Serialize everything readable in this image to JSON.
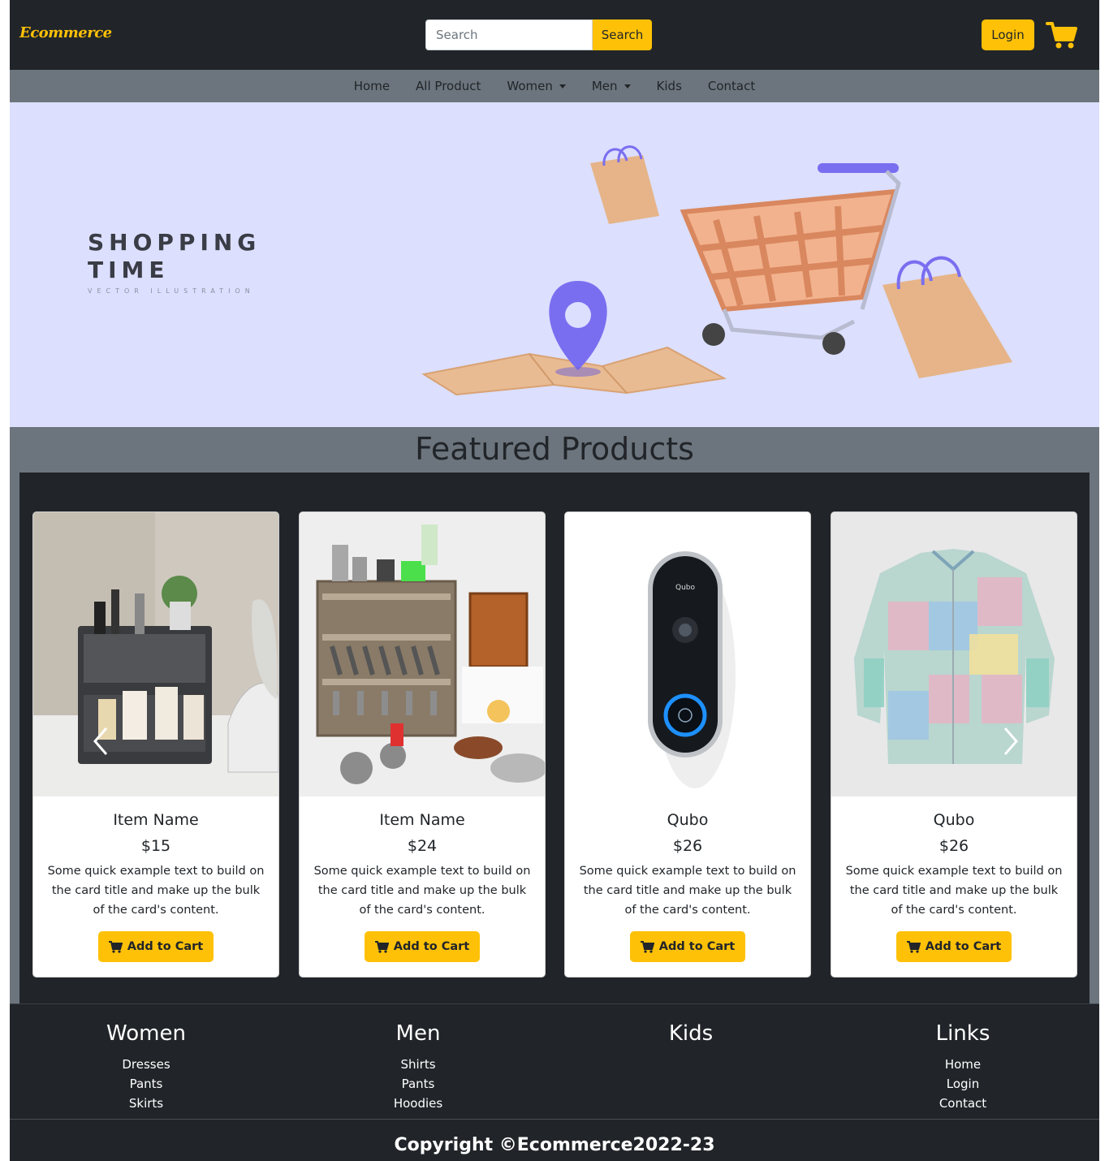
{
  "header": {
    "brand": "Ecommerce",
    "search_placeholder": "Search",
    "search_button": "Search",
    "login_button": "Login",
    "cart_icon": "shopping-cart-icon",
    "accent_color": "#ffc107"
  },
  "nav": {
    "items": [
      {
        "label": "Home",
        "dropdown": false
      },
      {
        "label": "All Product",
        "dropdown": false
      },
      {
        "label": "Women",
        "dropdown": true
      },
      {
        "label": "Men",
        "dropdown": true
      },
      {
        "label": "Kids",
        "dropdown": false
      },
      {
        "label": "Contact",
        "dropdown": false
      }
    ]
  },
  "hero": {
    "title_line1": "SHOPPING",
    "title_line2": "TIME",
    "subtitle": "VECTOR ILLUSTRATION"
  },
  "featured": {
    "title": "Featured Products",
    "products": [
      {
        "name": "Item Name",
        "price": "$15",
        "text": "Some quick example text to build on the card title and make up the bulk of the card's content.",
        "button": "Add to Cart"
      },
      {
        "name": "Item Name",
        "price": "$24",
        "text": "Some quick example text to build on the card title and make up the bulk of the card's content.",
        "button": "Add to Cart"
      },
      {
        "name": "Qubo",
        "price": "$26",
        "text": "Some quick example text to build on the card title and make up the bulk of the card's content.",
        "button": "Add to Cart"
      },
      {
        "name": "Qubo",
        "price": "$26",
        "text": "Some quick example text to build on the card title and make up the bulk of the card's content.",
        "button": "Add to Cart"
      }
    ],
    "doorbell_logo": "Qubo"
  },
  "footer": {
    "columns": [
      {
        "heading": "Women",
        "links": [
          "Dresses",
          "Pants",
          "Skirts"
        ]
      },
      {
        "heading": "Men",
        "links": [
          "Shirts",
          "Pants",
          "Hoodies"
        ]
      },
      {
        "heading": "Kids",
        "links": []
      },
      {
        "heading": "Links",
        "links": [
          "Home",
          "Login",
          "Contact"
        ]
      }
    ],
    "copyright": "Copyright ©Ecommerce2022-23"
  }
}
